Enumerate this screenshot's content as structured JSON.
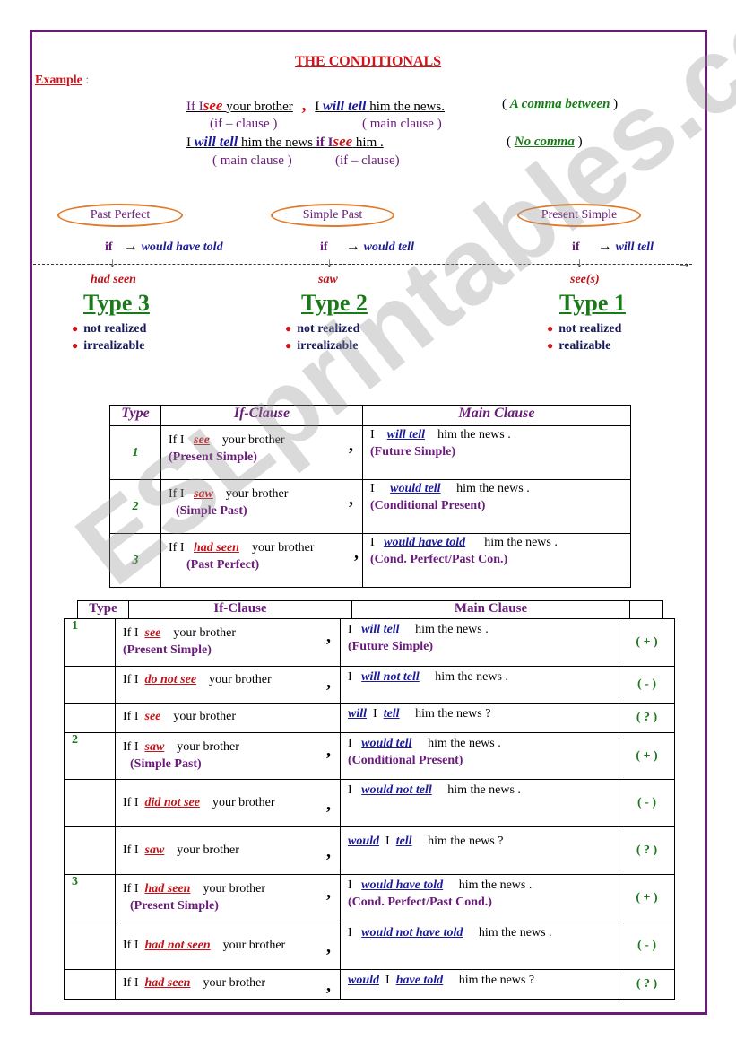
{
  "title": "THE CONDITIONALS",
  "example": {
    "label": "Example",
    "colon": ":",
    "line1": {
      "if": "If I",
      "verb1": "see",
      "rest1": "your brother",
      "comma": ",",
      "i": "I",
      "verb2": "will tell",
      "rest2": "him the news.",
      "note": "A comma between"
    },
    "line1_labels": {
      "left": "(if – clause )",
      "right": "( main clause )"
    },
    "line2": {
      "i": "I",
      "verb1": "will tell",
      "rest1": "him the news",
      "if": "if I",
      "verb2": "see",
      "rest2": "him .",
      "note": "No comma"
    },
    "line2_labels": {
      "left": "( main clause )",
      "right": "(if – clause)"
    }
  },
  "timeline": {
    "items": [
      {
        "tense_label": "Past Perfect",
        "if": "if",
        "arrow": "→",
        "result": "would have told",
        "form": "had seen",
        "type": "Type 3",
        "bullets": [
          "not realized",
          "irrealizable"
        ]
      },
      {
        "tense_label": "Simple Past",
        "if": "if",
        "arrow": "→",
        "result": "would tell",
        "form": "saw",
        "type": "Type 2",
        "bullets": [
          "not realized",
          "irrealizable"
        ]
      },
      {
        "tense_label": "Present Simple",
        "if": "if",
        "arrow": "→",
        "result": "will tell",
        "form": "see(s)",
        "type": "Type 1",
        "bullets": [
          "not realized",
          "realizable"
        ]
      }
    ]
  },
  "table1": {
    "headers": [
      "Type",
      "If-Clause",
      "Main Clause"
    ],
    "rows": [
      {
        "type": "1",
        "if_pre": "If I",
        "if_verb": "see",
        "if_post": "your brother",
        "if_tag": "(Present Simple)",
        "main_pre": "I",
        "main_verb": "will tell",
        "main_post": "him the news .",
        "main_tag": "(Future Simple)"
      },
      {
        "type": "2",
        "if_pre": "If I",
        "if_verb": "saw",
        "if_post": "your brother",
        "if_tag": "(Simple Past)",
        "main_pre": "I",
        "main_verb": "would tell",
        "main_post": "him the news .",
        "main_tag": "(Conditional Present)"
      },
      {
        "type": "3",
        "if_pre": "If I",
        "if_verb": "had  seen",
        "if_post": "your brother",
        "if_tag": "(Past Perfect)",
        "main_pre": "I",
        "main_verb": "would have told",
        "main_post": "him the news .",
        "main_tag": "(Cond. Perfect/Past Con.)"
      }
    ],
    "comma": ","
  },
  "table2": {
    "headers": [
      "Type",
      "If-Clause",
      "Main Clause",
      ""
    ],
    "rows": [
      {
        "type": "1",
        "if_pre": "If I",
        "if_verb": "see",
        "if_post": "your brother",
        "if_tag": "(Present Simple)",
        "comma": ",",
        "main_pre": "I",
        "main_verb": "will tell",
        "main_mid": "",
        "main_verb2": "",
        "main_post": "him the news .",
        "main_tag": "(Future Simple)",
        "sign": "( + )"
      },
      {
        "type": "",
        "if_pre": "If I",
        "if_verb": "do not  see",
        "if_post": "your brother",
        "if_tag": "",
        "comma": ",",
        "main_pre": "I",
        "main_verb": "will not tell",
        "main_mid": "",
        "main_verb2": "",
        "main_post": "him the news .",
        "main_tag": "",
        "sign": "(  -  )"
      },
      {
        "type": "",
        "if_pre": "If I",
        "if_verb": "see",
        "if_post": "your brother",
        "if_tag": "",
        "comma": "",
        "main_pre": "",
        "main_verb": "will",
        "main_mid": "I",
        "main_verb2": "tell",
        "main_post": "him the news ?",
        "main_tag": "",
        "sign": "( ? )"
      },
      {
        "type": "2",
        "if_pre": "If I",
        "if_verb": "saw",
        "if_post": "your brother",
        "if_tag": "(Simple Past)",
        "comma": ",",
        "main_pre": "I",
        "main_verb": "would tell",
        "main_mid": "",
        "main_verb2": "",
        "main_post": "him the news .",
        "main_tag": "(Conditional Present)",
        "sign": "( + )"
      },
      {
        "type": "",
        "if_pre": "If I",
        "if_verb": "did not  see",
        "if_post": "your brother",
        "if_tag": "",
        "comma": ",",
        "main_pre": "I",
        "main_verb": "would not tell",
        "main_mid": "",
        "main_verb2": "",
        "main_post": "him the news .",
        "main_tag": "",
        "sign": "(  -  )"
      },
      {
        "type": "",
        "if_pre": "If I",
        "if_verb": "saw",
        "if_post": "your brother",
        "if_tag": "",
        "comma": ",",
        "main_pre": "",
        "main_verb": "would",
        "main_mid": "I",
        "main_verb2": "tell",
        "main_post": "him the news ?",
        "main_tag": "",
        "sign": "( ? )"
      },
      {
        "type": "3",
        "if_pre": "If I",
        "if_verb": "had seen",
        "if_post": "your brother",
        "if_tag": "(Present Simple)",
        "comma": ",",
        "main_pre": "I",
        "main_verb": "would have told",
        "main_mid": "",
        "main_verb2": "",
        "main_post": "him the news .",
        "main_tag": "(Cond. Perfect/Past Cond.)",
        "sign": "( + )"
      },
      {
        "type": "",
        "if_pre": "If I",
        "if_verb": "had not  seen",
        "if_post": "your brother",
        "if_tag": "",
        "comma": ",",
        "main_pre": "I",
        "main_verb": "would not have told",
        "main_mid": "",
        "main_verb2": "",
        "main_post": "him the news .",
        "main_tag": "",
        "sign": "(  -  )"
      },
      {
        "type": "",
        "if_pre": "If I",
        "if_verb": "had  seen",
        "if_post": "your brother",
        "if_tag": "",
        "comma": ",",
        "main_pre": "",
        "main_verb": "would",
        "main_mid": "I",
        "main_verb2": "have told",
        "main_post": "him the news ?",
        "main_tag": "",
        "sign": "( ? )"
      }
    ]
  },
  "watermark": "ESLprintables.com",
  "colors": {
    "frame": "#6a1b7a",
    "title_red": "#d0141a",
    "verb_blue": "#1a1a9a",
    "type_green": "#1a7a1a",
    "oval_orange": "#e27a2a"
  }
}
